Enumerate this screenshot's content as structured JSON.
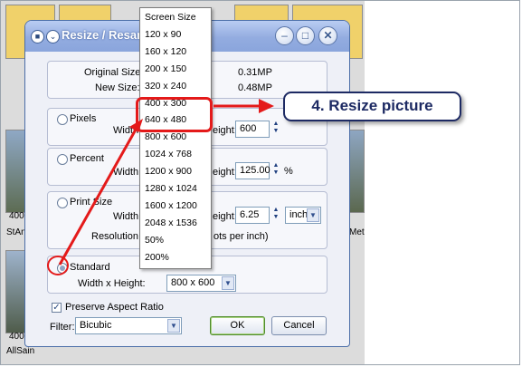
{
  "background_app": {
    "side_labels": [
      "400",
      "StAn",
      "400",
      "AllSain"
    ],
    "right_labels": [
      "Met"
    ]
  },
  "dialog": {
    "title": "Resize / Resam",
    "original_size_label": "Original Size:",
    "original_size_value": "0.31MP",
    "new_size_label": "New Size:",
    "new_size_value": "0.48MP",
    "pixels": {
      "label": "Pixels",
      "width_label": "Width:",
      "height_label": "eight:",
      "height_value": "600"
    },
    "percent": {
      "label": "Percent",
      "width_label": "Width:",
      "height_label": "eight:",
      "height_value": "125.00",
      "unit": "%"
    },
    "print_size": {
      "label": "Print Size",
      "width_label": "Width:",
      "height_label": "eight:",
      "height_value": "6.25",
      "unit": "inch",
      "resolution_label": "Resolution:",
      "resolution_unit": "ots per inch)"
    },
    "standard": {
      "label": "Standard",
      "wh_label": "Width x Height:",
      "wh_value": "800 x 600"
    },
    "preserve_label": "Preserve Aspect Ratio",
    "filter_label": "Filter:",
    "filter_value": "Bicubic",
    "ok_label": "OK",
    "cancel_label": "Cancel"
  },
  "size_list": {
    "options": [
      "Screen Size",
      "120 x 90",
      "160 x 120",
      "200 x 150",
      "320 x 240",
      "400 x 300",
      "640 x 480",
      "800 x 600",
      "1024 x 768",
      "1200 x 900",
      "1280 x 1024",
      "1600 x 1200",
      "2048 x 1536",
      "50%",
      "200%"
    ]
  },
  "callout": {
    "text": "4. Resize picture"
  },
  "colors": {
    "annotation_red": "#e41a1a",
    "callout_navy": "#1d2a63",
    "title_blue": "#93ace0"
  }
}
